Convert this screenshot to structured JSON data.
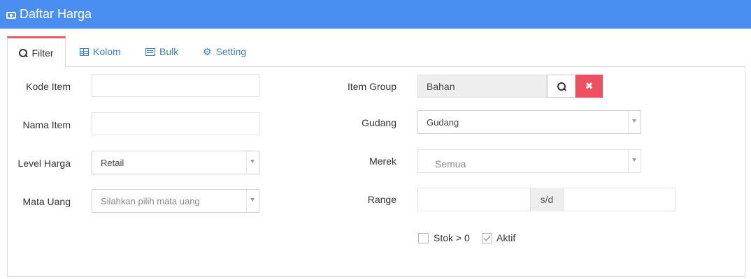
{
  "header": {
    "title": "Daftar Harga",
    "icon": "money-icon"
  },
  "tabs": [
    {
      "label": "Filter",
      "icon": "search-icon",
      "active": true
    },
    {
      "label": "Kolom",
      "icon": "table-icon",
      "active": false
    },
    {
      "label": "Bulk",
      "icon": "list-icon",
      "active": false
    },
    {
      "label": "Setting",
      "icon": "gears-icon",
      "active": false
    }
  ],
  "filter": {
    "kode_item": {
      "label": "Kode Item",
      "value": ""
    },
    "nama_item": {
      "label": "Nama Item",
      "value": ""
    },
    "level_harga": {
      "label": "Level Harga",
      "value": "Retail"
    },
    "mata_uang": {
      "label": "Mata Uang",
      "placeholder": "Silahkan pilih mata uang"
    },
    "item_group": {
      "label": "Item Group",
      "value": "Bahan"
    },
    "gudang": {
      "label": "Gudang",
      "value": "Gudang"
    },
    "merek": {
      "label": "Merek",
      "value": "Semua"
    },
    "range": {
      "label": "Range",
      "from": "",
      "separator": "s/d",
      "to": ""
    },
    "stok": {
      "label": "Stok > 0",
      "checked": false
    },
    "aktif": {
      "label": "Aktif",
      "checked": true
    }
  },
  "colors": {
    "header_bg": "#4a8ef2",
    "tab_active_border": "#e05c6b",
    "clear_button": "#ef4f5f",
    "link": "#3c7fc6"
  }
}
